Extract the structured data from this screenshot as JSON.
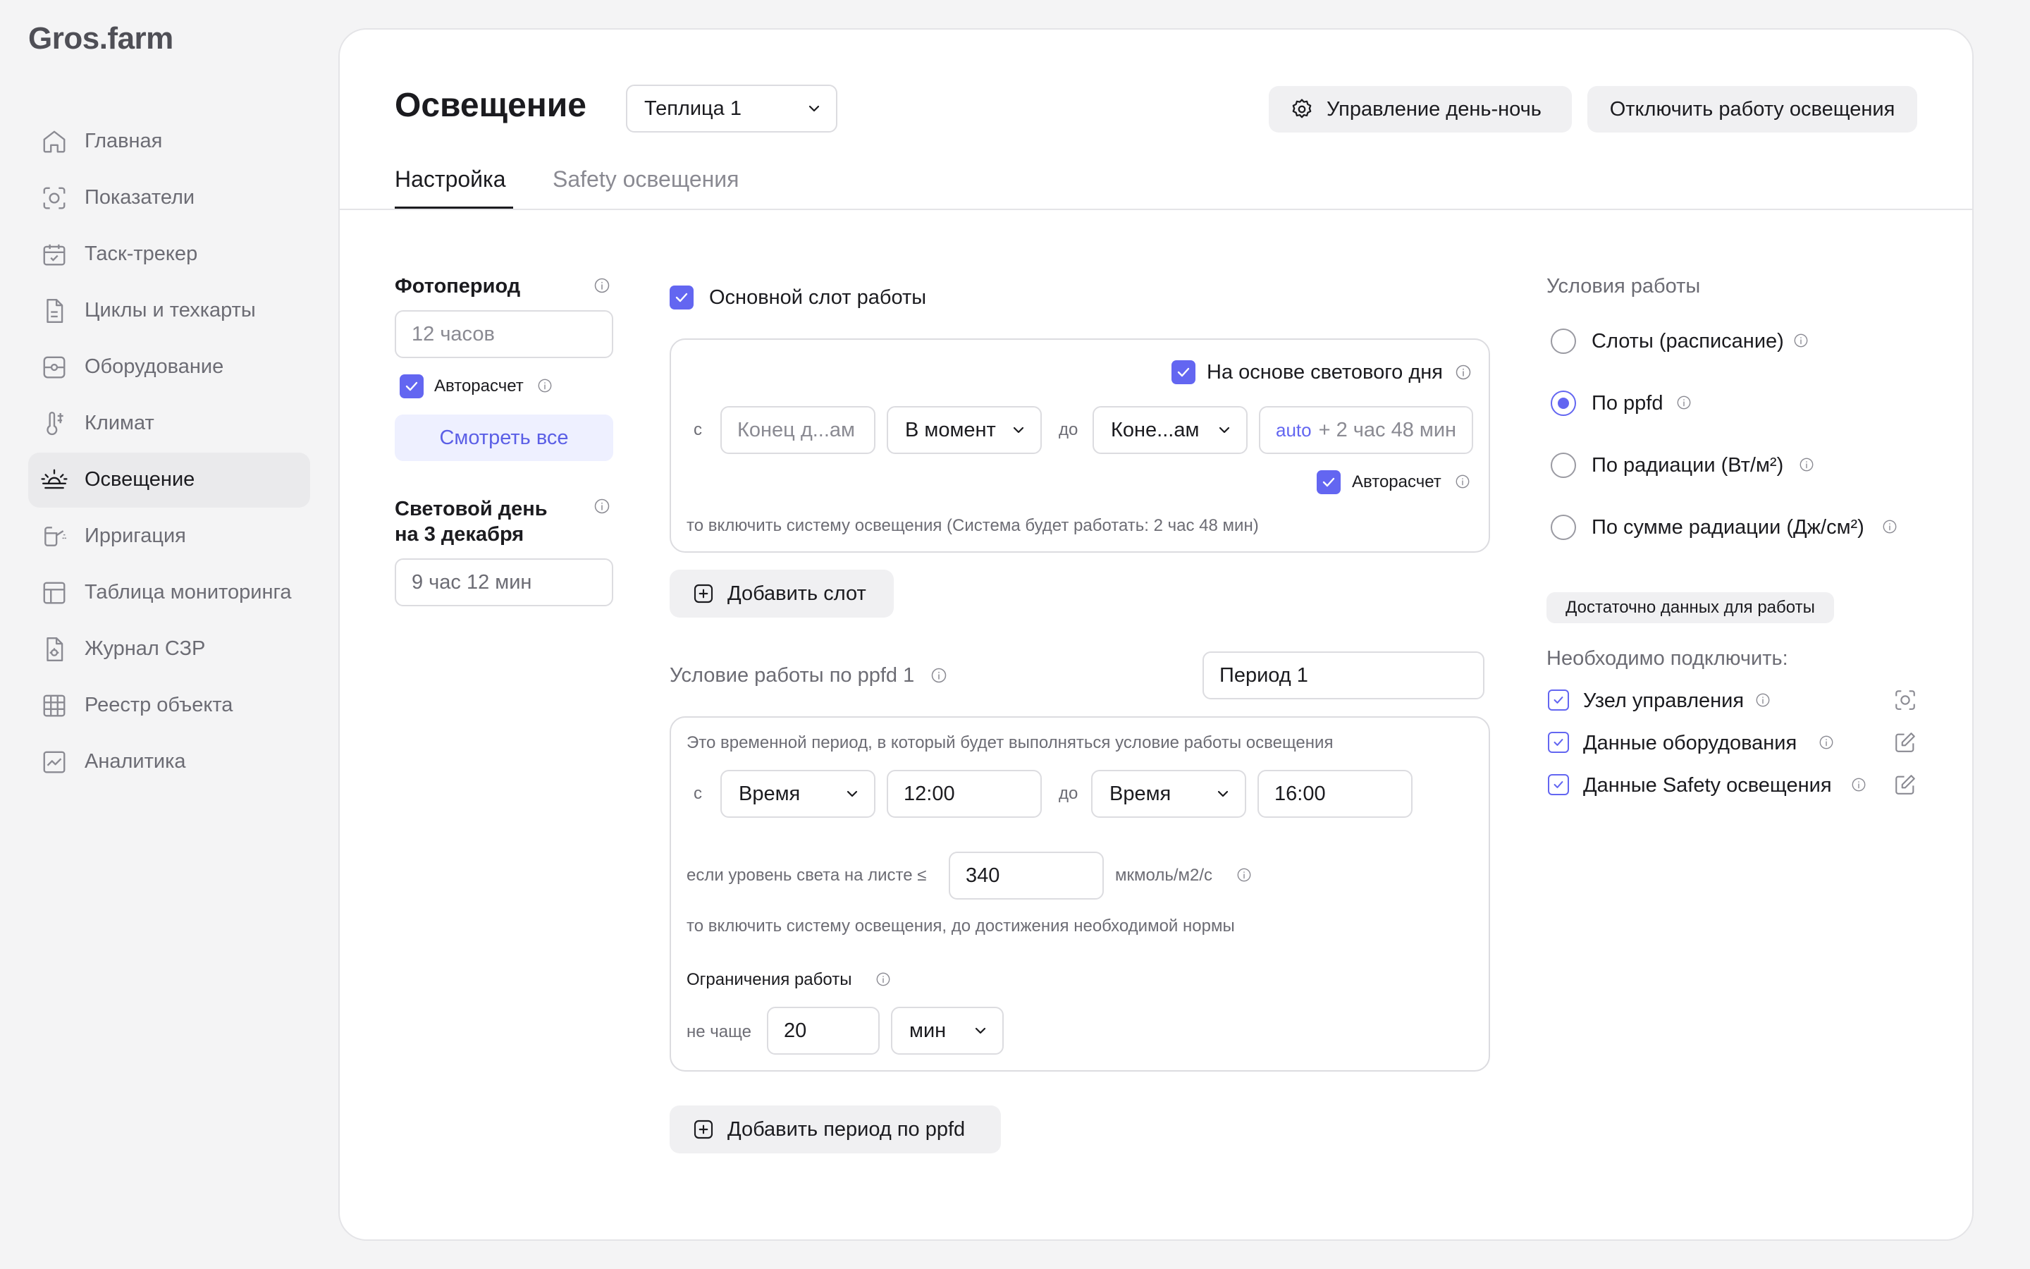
{
  "app": {
    "logo": "Gros.farm"
  },
  "sidebar": {
    "items": [
      {
        "label": "Главная",
        "icon": "home-icon"
      },
      {
        "label": "Показатели",
        "icon": "sensor-icon"
      },
      {
        "label": "Таск-трекер",
        "icon": "calendar-check-icon"
      },
      {
        "label": "Циклы и техкарты",
        "icon": "document-icon"
      },
      {
        "label": "Оборудование",
        "icon": "equipment-icon"
      },
      {
        "label": "Климат",
        "icon": "thermometer-icon"
      },
      {
        "label": "Освещение",
        "icon": "sunrise-icon",
        "active": true
      },
      {
        "label": "Ирригация",
        "icon": "watering-icon"
      },
      {
        "label": "Таблица мониторинга",
        "icon": "table-icon"
      },
      {
        "label": "Журнал СЗР",
        "icon": "journal-icon"
      },
      {
        "label": "Реестр объекта",
        "icon": "grid-icon"
      },
      {
        "label": "Аналитика",
        "icon": "analytics-icon"
      }
    ]
  },
  "header": {
    "title": "Освещение",
    "greenhouse_select": "Теплица 1",
    "day_night_button": "Управление день-ночь",
    "disable_button": "Отключить работу освещения"
  },
  "tabs": [
    {
      "label": "Настройка",
      "active": true
    },
    {
      "label": "Safety освещения",
      "active": false
    }
  ],
  "left": {
    "photoperiod_label": "Фотопериод",
    "photoperiod_placeholder": "12 часов",
    "autocalc_label": "Авторасчет",
    "view_all": "Смотреть все",
    "daylight_label_1": "Световой день",
    "daylight_label_2": "на 3 декабря",
    "daylight_value": "9 час 12 мин"
  },
  "slot": {
    "main_slot_label": "Основной слот работы",
    "daylight_based_label": "На основе светового дня",
    "from_label": "с",
    "from_placeholder": "Конец д...ам",
    "moment_select": "В момент",
    "to_label": "до",
    "to_select": "Коне...ам",
    "auto_tag": "auto",
    "auto_value": "+ 2 час 48 мин",
    "autocalc_label": "Авторасчет",
    "note": "то включить систему освещения (Система будет работать: 2 час 48 мин)",
    "add_slot_button": "Добавить слот"
  },
  "ppfd": {
    "title": "Условие работы по ppfd 1",
    "period_name": "Период 1",
    "description": "Это временной период, в который будет выполняться условие работы освещения",
    "from_label": "с",
    "from_type": "Время",
    "from_time": "12:00",
    "to_label": "до",
    "to_type": "Время",
    "to_time": "16:00",
    "condition_label": "если уровень света на листе ≤",
    "threshold": "340",
    "unit": "мкмоль/м2/с",
    "result_note": "то включить систему освещения, до достижения необходимой нормы",
    "limits_label": "Ограничения работы",
    "not_more_label": "не чаще",
    "interval_value": "20",
    "interval_unit": "мин",
    "add_period_button": "Добавить период по ppfd"
  },
  "conditions": {
    "title": "Условия работы",
    "options": [
      {
        "label": "Слоты (расписание)",
        "selected": false
      },
      {
        "label": "По ppfd",
        "selected": true
      },
      {
        "label": "По радиации (Вт/м²)",
        "selected": false
      },
      {
        "label": "По сумме радиации (Дж/см²)",
        "selected": false
      }
    ],
    "enough_data_chip": "Достаточно данных для работы",
    "need_connect_label": "Необходимо подключить:",
    "requirements": [
      {
        "label": "Узел управления",
        "icon": "sensor-icon"
      },
      {
        "label": "Данные оборудования",
        "icon": "edit-icon"
      },
      {
        "label": "Данные Safety освещения",
        "icon": "edit-icon"
      }
    ]
  },
  "colors": {
    "accent": "#6366f1",
    "text": "#1b1b1f",
    "muted": "#6c6c74",
    "border": "#dcdce0"
  }
}
